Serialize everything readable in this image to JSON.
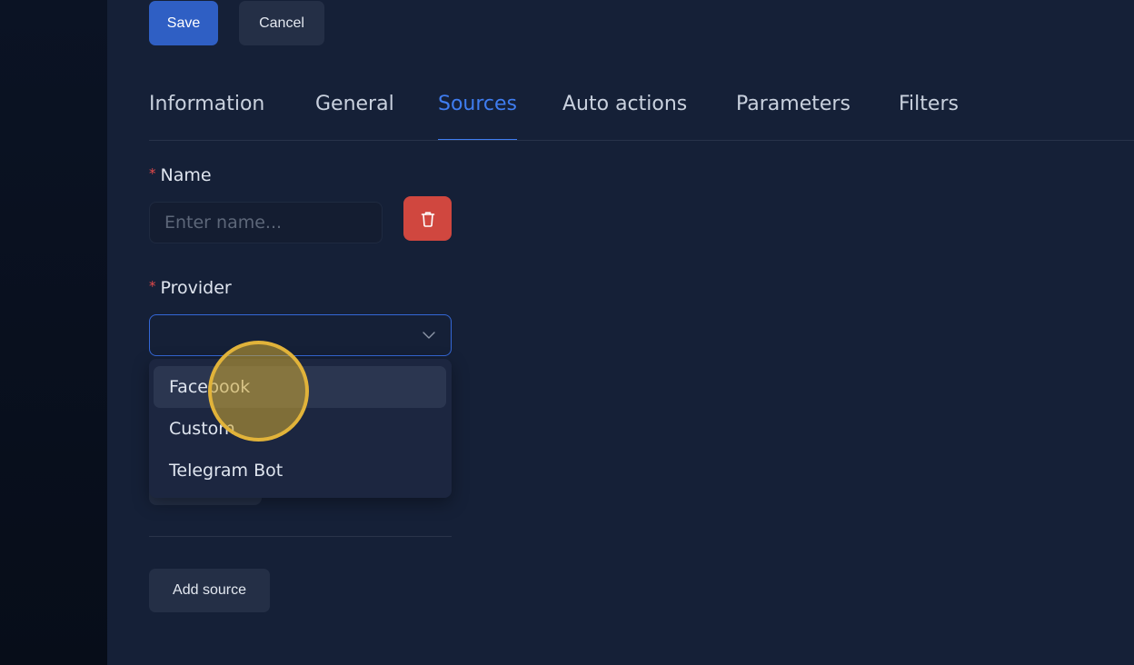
{
  "toolbar": {
    "save_label": "Save",
    "cancel_label": "Cancel"
  },
  "tabs": [
    {
      "label": "Information",
      "active": false
    },
    {
      "label": "General",
      "active": false
    },
    {
      "label": "Sources",
      "active": true
    },
    {
      "label": "Auto actions",
      "active": false
    },
    {
      "label": "Parameters",
      "active": false
    },
    {
      "label": "Filters",
      "active": false
    }
  ],
  "form": {
    "name": {
      "required_mark": "*",
      "label": "Name",
      "value": "",
      "placeholder": "Enter name..."
    },
    "provider": {
      "required_mark": "*",
      "label": "Provider",
      "value": "",
      "options": [
        "Facebook",
        "Custom",
        "Telegram Bot"
      ],
      "hovered_option": "Facebook"
    }
  },
  "add_source_label": "Add source",
  "icons": {
    "delete": "trash-icon",
    "select": "chevron-down-icon"
  },
  "colors": {
    "accent": "#3f7df0",
    "save_button": "#2f5fc4",
    "delete_button": "#d0473f",
    "required": "#e54a4a",
    "cursor_highlight": "#e1b33a"
  }
}
